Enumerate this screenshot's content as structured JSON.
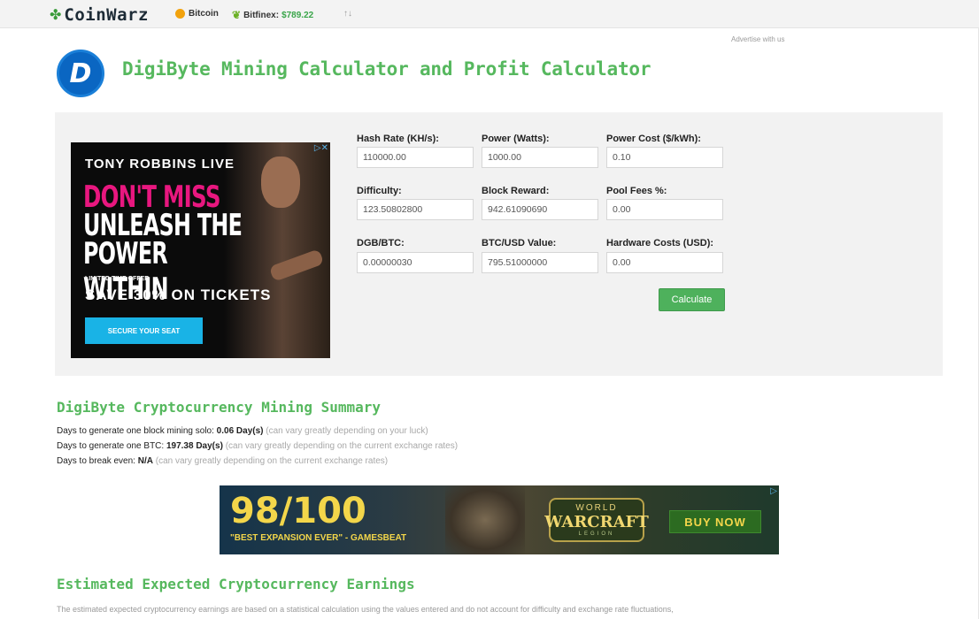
{
  "topbar": {
    "brand": "CoinWarz",
    "ticker_coin": "Bitcoin",
    "ticker_exchange": "Bitfinex:",
    "ticker_price": "$789.22",
    "sort_arrows": "↑↓"
  },
  "advertise": "Advertise with us",
  "title": {
    "logo_letter": "D",
    "text": "DigiByte Mining Calculator and Profit Calculator"
  },
  "ad_top": {
    "line1": "TONY ROBBINS LIVE",
    "line2": "DON'T MISS",
    "line3": "UNLEASH THE",
    "line4": "POWER WITHIN",
    "line5": "LIMITED TIME OFFER",
    "line6": "SAVE 30% ON TICKETS",
    "button": "SECURE YOUR SEAT",
    "close": "▷✕"
  },
  "calculator": {
    "fields": [
      {
        "label": "Hash Rate (KH/s):",
        "value": "110000.00"
      },
      {
        "label": "Power (Watts):",
        "value": "1000.00"
      },
      {
        "label": "Power Cost ($/kWh):",
        "value": "0.10"
      },
      {
        "label": "Difficulty:",
        "value": "123.50802800"
      },
      {
        "label": "Block Reward:",
        "value": "942.61090690"
      },
      {
        "label": "Pool Fees %:",
        "value": "0.00"
      },
      {
        "label": "DGB/BTC:",
        "value": "0.00000030"
      },
      {
        "label": "BTC/USD Value:",
        "value": "795.51000000"
      },
      {
        "label": "Hardware Costs (USD):",
        "value": "0.00"
      }
    ],
    "button": "Calculate"
  },
  "summary": {
    "heading": "DigiByte Cryptocurrency Mining Summary",
    "lines": [
      {
        "prefix": "Days to generate one block mining solo:",
        "value": "0.06 Day(s)",
        "note": "(can vary greatly depending on your luck)"
      },
      {
        "prefix": "Days to generate one BTC:",
        "value": "197.38 Day(s)",
        "note": "(can vary greatly depending on the current exchange rates)"
      },
      {
        "prefix": "Days to break even:",
        "value": "N/A",
        "note": "(can vary greatly depending on the current exchange rates)"
      }
    ]
  },
  "ad_bottom": {
    "score": "98/100",
    "quote": "\"BEST EXPANSION EVER\" - GAMESBEAT",
    "logo_top": "WORLD",
    "logo_mid": "WARCRAFT",
    "logo_bottom": "LEGION",
    "buy": "BUY NOW",
    "close": "▷"
  },
  "earnings": {
    "heading": "Estimated Expected Cryptocurrency Earnings",
    "text": "The estimated expected cryptocurrency earnings are based on a statistical calculation using the values entered and do not account for difficulty and exchange rate fluctuations,"
  }
}
